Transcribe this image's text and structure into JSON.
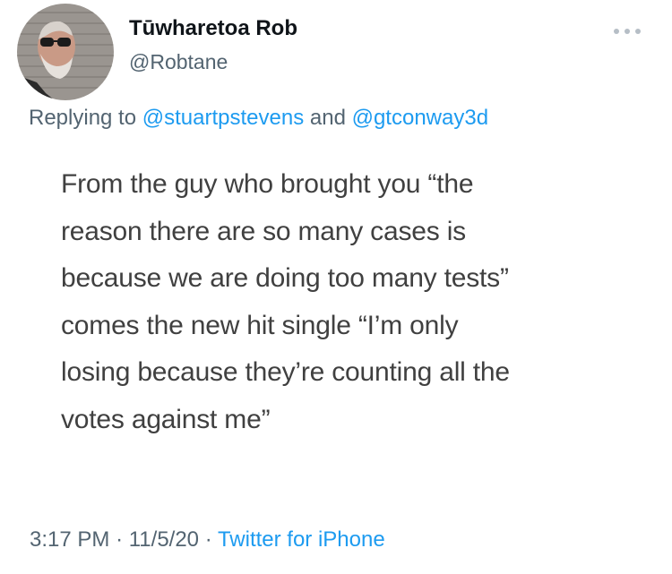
{
  "author": {
    "display_name": "Tūwharetoa Rob",
    "handle": "@Robtane",
    "avatar_icon": "profile-photo"
  },
  "more_icon": "more-horizontal-icon",
  "reply": {
    "prefix": "Replying to",
    "mention_1": "@stuartpstevens",
    "conjunction": "and",
    "mention_2": "@gtconway3d"
  },
  "tweet_image": {
    "lines": [
      "From the guy who brought you “the",
      "reason there are so many cases is",
      "because we are doing too many tests”",
      "comes the new hit single “I’m only",
      "losing because they’re counting all the",
      "votes against me”"
    ]
  },
  "meta": {
    "time": "3:17 PM",
    "separator": "·",
    "date": "11/5/20",
    "source": "Twitter for iPhone"
  },
  "colors": {
    "link": "#1d9bf0",
    "secondary_text": "#536471",
    "primary_text": "#0f1419",
    "image_text": "#404040"
  }
}
